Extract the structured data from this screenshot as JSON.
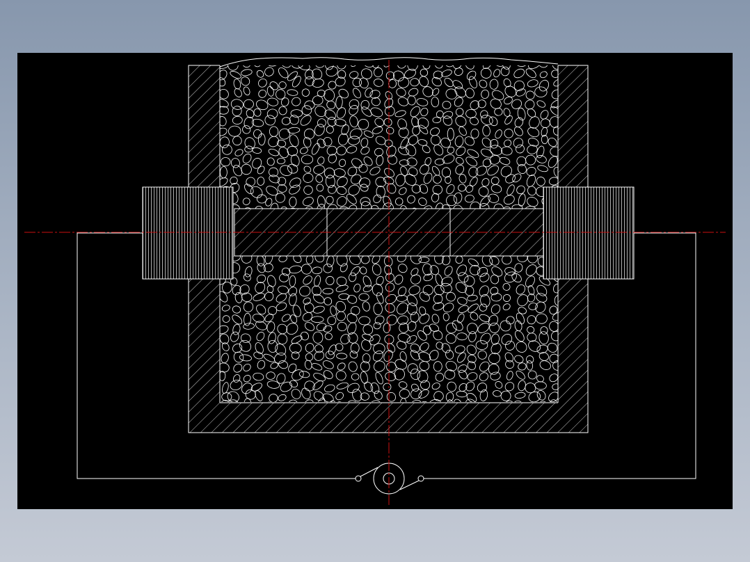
{
  "drawing": {
    "colors": {
      "background_outer": "#8797ad",
      "canvas": "#000000",
      "line": "#ffffff",
      "centerline": "#cc1111"
    },
    "parts": [
      {
        "id": "container",
        "pattern": "diagonal-hatch"
      },
      {
        "id": "granular-fill-upper",
        "pattern": "pebbles"
      },
      {
        "id": "granular-fill-lower",
        "pattern": "pebbles"
      },
      {
        "id": "core-bar",
        "pattern": "cross-hatch-3-segments"
      },
      {
        "id": "left-electrode",
        "pattern": "vertical-lines"
      },
      {
        "id": "right-electrode",
        "pattern": "vertical-lines"
      },
      {
        "id": "power-source",
        "symbol": "circle-with-switch"
      }
    ]
  }
}
